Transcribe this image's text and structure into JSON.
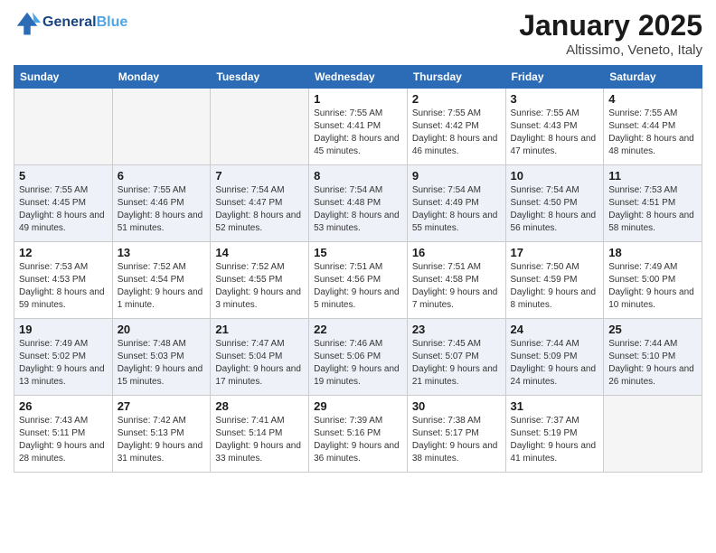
{
  "header": {
    "logo_line1": "General",
    "logo_line2": "Blue",
    "month": "January 2025",
    "location": "Altissimo, Veneto, Italy"
  },
  "weekdays": [
    "Sunday",
    "Monday",
    "Tuesday",
    "Wednesday",
    "Thursday",
    "Friday",
    "Saturday"
  ],
  "weeks": [
    [
      {
        "day": "",
        "empty": true
      },
      {
        "day": "",
        "empty": true
      },
      {
        "day": "",
        "empty": true
      },
      {
        "day": "1",
        "sunrise": "Sunrise: 7:55 AM",
        "sunset": "Sunset: 4:41 PM",
        "daylight": "Daylight: 8 hours and 45 minutes."
      },
      {
        "day": "2",
        "sunrise": "Sunrise: 7:55 AM",
        "sunset": "Sunset: 4:42 PM",
        "daylight": "Daylight: 8 hours and 46 minutes."
      },
      {
        "day": "3",
        "sunrise": "Sunrise: 7:55 AM",
        "sunset": "Sunset: 4:43 PM",
        "daylight": "Daylight: 8 hours and 47 minutes."
      },
      {
        "day": "4",
        "sunrise": "Sunrise: 7:55 AM",
        "sunset": "Sunset: 4:44 PM",
        "daylight": "Daylight: 8 hours and 48 minutes."
      }
    ],
    [
      {
        "day": "5",
        "sunrise": "Sunrise: 7:55 AM",
        "sunset": "Sunset: 4:45 PM",
        "daylight": "Daylight: 8 hours and 49 minutes."
      },
      {
        "day": "6",
        "sunrise": "Sunrise: 7:55 AM",
        "sunset": "Sunset: 4:46 PM",
        "daylight": "Daylight: 8 hours and 51 minutes."
      },
      {
        "day": "7",
        "sunrise": "Sunrise: 7:54 AM",
        "sunset": "Sunset: 4:47 PM",
        "daylight": "Daylight: 8 hours and 52 minutes."
      },
      {
        "day": "8",
        "sunrise": "Sunrise: 7:54 AM",
        "sunset": "Sunset: 4:48 PM",
        "daylight": "Daylight: 8 hours and 53 minutes."
      },
      {
        "day": "9",
        "sunrise": "Sunrise: 7:54 AM",
        "sunset": "Sunset: 4:49 PM",
        "daylight": "Daylight: 8 hours and 55 minutes."
      },
      {
        "day": "10",
        "sunrise": "Sunrise: 7:54 AM",
        "sunset": "Sunset: 4:50 PM",
        "daylight": "Daylight: 8 hours and 56 minutes."
      },
      {
        "day": "11",
        "sunrise": "Sunrise: 7:53 AM",
        "sunset": "Sunset: 4:51 PM",
        "daylight": "Daylight: 8 hours and 58 minutes."
      }
    ],
    [
      {
        "day": "12",
        "sunrise": "Sunrise: 7:53 AM",
        "sunset": "Sunset: 4:53 PM",
        "daylight": "Daylight: 8 hours and 59 minutes."
      },
      {
        "day": "13",
        "sunrise": "Sunrise: 7:52 AM",
        "sunset": "Sunset: 4:54 PM",
        "daylight": "Daylight: 9 hours and 1 minute."
      },
      {
        "day": "14",
        "sunrise": "Sunrise: 7:52 AM",
        "sunset": "Sunset: 4:55 PM",
        "daylight": "Daylight: 9 hours and 3 minutes."
      },
      {
        "day": "15",
        "sunrise": "Sunrise: 7:51 AM",
        "sunset": "Sunset: 4:56 PM",
        "daylight": "Daylight: 9 hours and 5 minutes."
      },
      {
        "day": "16",
        "sunrise": "Sunrise: 7:51 AM",
        "sunset": "Sunset: 4:58 PM",
        "daylight": "Daylight: 9 hours and 7 minutes."
      },
      {
        "day": "17",
        "sunrise": "Sunrise: 7:50 AM",
        "sunset": "Sunset: 4:59 PM",
        "daylight": "Daylight: 9 hours and 8 minutes."
      },
      {
        "day": "18",
        "sunrise": "Sunrise: 7:49 AM",
        "sunset": "Sunset: 5:00 PM",
        "daylight": "Daylight: 9 hours and 10 minutes."
      }
    ],
    [
      {
        "day": "19",
        "sunrise": "Sunrise: 7:49 AM",
        "sunset": "Sunset: 5:02 PM",
        "daylight": "Daylight: 9 hours and 13 minutes."
      },
      {
        "day": "20",
        "sunrise": "Sunrise: 7:48 AM",
        "sunset": "Sunset: 5:03 PM",
        "daylight": "Daylight: 9 hours and 15 minutes."
      },
      {
        "day": "21",
        "sunrise": "Sunrise: 7:47 AM",
        "sunset": "Sunset: 5:04 PM",
        "daylight": "Daylight: 9 hours and 17 minutes."
      },
      {
        "day": "22",
        "sunrise": "Sunrise: 7:46 AM",
        "sunset": "Sunset: 5:06 PM",
        "daylight": "Daylight: 9 hours and 19 minutes."
      },
      {
        "day": "23",
        "sunrise": "Sunrise: 7:45 AM",
        "sunset": "Sunset: 5:07 PM",
        "daylight": "Daylight: 9 hours and 21 minutes."
      },
      {
        "day": "24",
        "sunrise": "Sunrise: 7:44 AM",
        "sunset": "Sunset: 5:09 PM",
        "daylight": "Daylight: 9 hours and 24 minutes."
      },
      {
        "day": "25",
        "sunrise": "Sunrise: 7:44 AM",
        "sunset": "Sunset: 5:10 PM",
        "daylight": "Daylight: 9 hours and 26 minutes."
      }
    ],
    [
      {
        "day": "26",
        "sunrise": "Sunrise: 7:43 AM",
        "sunset": "Sunset: 5:11 PM",
        "daylight": "Daylight: 9 hours and 28 minutes."
      },
      {
        "day": "27",
        "sunrise": "Sunrise: 7:42 AM",
        "sunset": "Sunset: 5:13 PM",
        "daylight": "Daylight: 9 hours and 31 minutes."
      },
      {
        "day": "28",
        "sunrise": "Sunrise: 7:41 AM",
        "sunset": "Sunset: 5:14 PM",
        "daylight": "Daylight: 9 hours and 33 minutes."
      },
      {
        "day": "29",
        "sunrise": "Sunrise: 7:39 AM",
        "sunset": "Sunset: 5:16 PM",
        "daylight": "Daylight: 9 hours and 36 minutes."
      },
      {
        "day": "30",
        "sunrise": "Sunrise: 7:38 AM",
        "sunset": "Sunset: 5:17 PM",
        "daylight": "Daylight: 9 hours and 38 minutes."
      },
      {
        "day": "31",
        "sunrise": "Sunrise: 7:37 AM",
        "sunset": "Sunset: 5:19 PM",
        "daylight": "Daylight: 9 hours and 41 minutes."
      },
      {
        "day": "",
        "empty": true
      }
    ]
  ]
}
